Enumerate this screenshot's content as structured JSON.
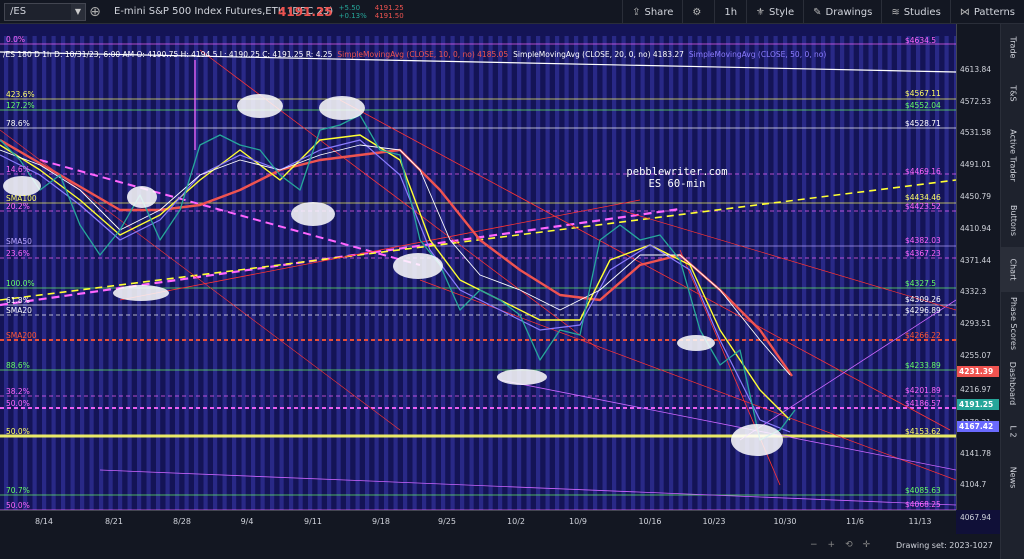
{
  "toolbar": {
    "symbol": "/ES",
    "description": "E-mini S&P 500 Index Futures,ETH (DEC 23)",
    "last_price": "4191.25",
    "change": "+5.50",
    "change_pct": "+0.13%",
    "bid": "4191.25",
    "ask": "4191.50",
    "share": "Share",
    "interval": "1h",
    "style": "Style",
    "drawings": "Drawings",
    "studies": "Studies",
    "patterns": "Patterns"
  },
  "legend": {
    "ohlc": "/ES 180 D 1h   D: 10/31/23, 6:00 AM   O: 4190.75   H: 4194.5   L: 4190.25   C: 4191.25   R: 4.25",
    "sma10": "SimpleMovingAvg (CLOSE, 10, 0, no)   4185.05",
    "sma20": "SimpleMovingAvg (CLOSE, 20, 0, no)   4183.27",
    "sma50": "SimpleMovingAvg (CLOSE, 50, 0, no)"
  },
  "watermark": {
    "line1": "pebblewriter.com",
    "line2": "ES 60-min"
  },
  "levels_left": [
    {
      "text": "0.0%",
      "color": "#ff66ff"
    },
    {
      "text": "423.6%",
      "color": "#ffff66"
    },
    {
      "text": "127.2%",
      "color": "#66ff66"
    },
    {
      "text": "78.6%",
      "color": "#ffffff"
    },
    {
      "text": "14.6%",
      "color": "#ff66ff"
    },
    {
      "text": "SMA100",
      "color": "#ffff66"
    },
    {
      "text": "20.2%",
      "color": "#ff66ff"
    },
    {
      "text": "SMA50",
      "color": "#b9a6ff"
    },
    {
      "text": "23.6%",
      "color": "#ff66ff"
    },
    {
      "text": "100.0%",
      "color": "#66ff66"
    },
    {
      "text": "61.8%",
      "color": "#ffffff"
    },
    {
      "text": "SMA20",
      "color": "#ffffff"
    },
    {
      "text": "SMA200",
      "color": "#ff5533"
    },
    {
      "text": "88.6%",
      "color": "#66ff66"
    },
    {
      "text": "38.2%",
      "color": "#ff66ff"
    },
    {
      "text": "50.0%",
      "color": "#ff66ff"
    },
    {
      "text": "50.0%",
      "color": "#ffff66"
    },
    {
      "text": "70.7%",
      "color": "#66ff66"
    },
    {
      "text": "50.0%",
      "color": "#ff66ff"
    }
  ],
  "levels_right": [
    {
      "text": "$4634.5",
      "color": "#ff66ff"
    },
    {
      "text": "$4567.11",
      "color": "#ffff66"
    },
    {
      "text": "$4552.04",
      "color": "#66ff66"
    },
    {
      "text": "$4528.71",
      "color": "#ffffff"
    },
    {
      "text": "$4469.16",
      "color": "#ff66ff"
    },
    {
      "text": "$4434.46",
      "color": "#ffff66"
    },
    {
      "text": "$4423.52",
      "color": "#ff66ff"
    },
    {
      "text": "$4382.03",
      "color": "#ff66ff"
    },
    {
      "text": "$4367.23",
      "color": "#ff66ff"
    },
    {
      "text": "$4327.5",
      "color": "#66ff66"
    },
    {
      "text": "$4309.26",
      "color": "#ffffff"
    },
    {
      "text": "$4296.89",
      "color": "#ffffff"
    },
    {
      "text": "$4266.22",
      "color": "#ff5533"
    },
    {
      "text": "$4233.89",
      "color": "#66ff66"
    },
    {
      "text": "$4201.89",
      "color": "#ff66ff"
    },
    {
      "text": "$4186.57",
      "color": "#ff66ff"
    },
    {
      "text": "$4153.62",
      "color": "#ffff66"
    },
    {
      "text": "$4085.63",
      "color": "#66ff66"
    },
    {
      "text": "$4068.25",
      "color": "#ff66ff"
    }
  ],
  "price_axis": [
    "4613.84",
    "4572.53",
    "4531.58",
    "4491.01",
    "4450.79",
    "4410.94",
    "4371.44",
    "4332.3",
    "4293.51",
    "4255.07",
    "4216.97",
    "4179.21",
    "4141.78",
    "4104.7",
    "4067.94"
  ],
  "price_tags": [
    {
      "text": "4231.39",
      "bg": "#ef5350"
    },
    {
      "text": "4191.25",
      "bg": "#26a69a"
    },
    {
      "text": "4167.42",
      "bg": "#6a6aff"
    }
  ],
  "time_axis": [
    "8/14",
    "8/21",
    "8/28",
    "9/4",
    "9/11",
    "9/18",
    "9/25",
    "10/2",
    "10/9",
    "10/16",
    "10/23",
    "10/30",
    "11/6",
    "11/13"
  ],
  "sidebar": [
    "Trade",
    "T&S",
    "Active Trader",
    "Buttons",
    "Chart",
    "Phase Scores",
    "Dashboard",
    "L 2",
    "News"
  ],
  "status": {
    "drawing_set": "Drawing set: 2023-1027"
  },
  "colors": {
    "background": "#141456",
    "stripe": "#3a3ab0",
    "sma10": "#ef5350",
    "sma20": "#ffff33",
    "sma50": "#8c7cff",
    "price": "#26a69a"
  }
}
